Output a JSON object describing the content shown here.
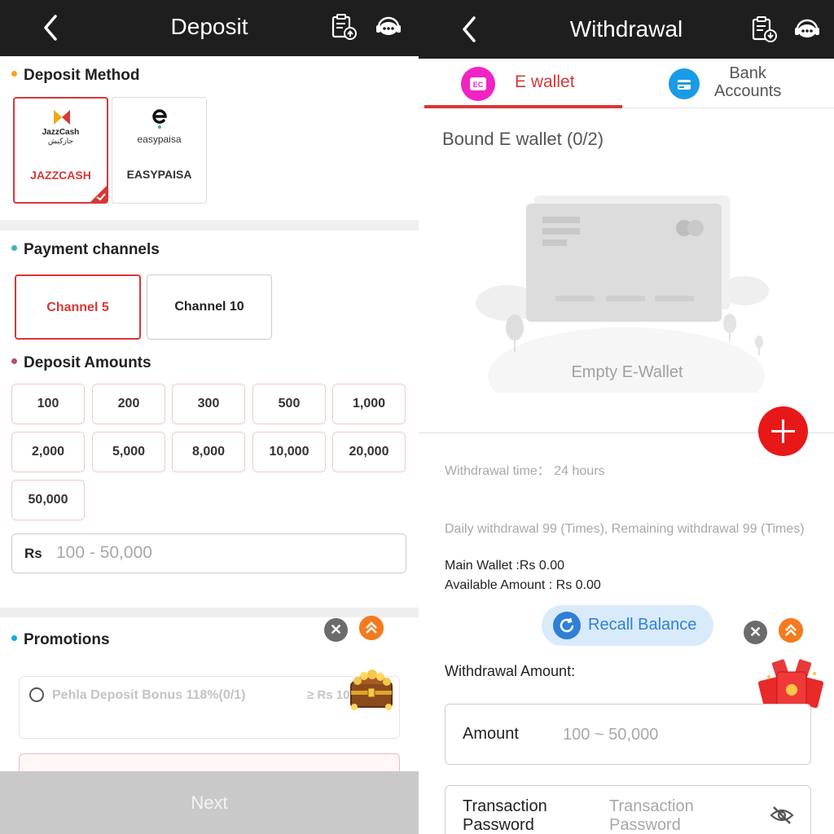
{
  "deposit": {
    "title": "Deposit",
    "method_title": "Deposit Method",
    "methods": [
      {
        "logo_line1": "JazzCash",
        "logo_line2": "جازکیش",
        "label": "JAZZCASH",
        "selected": true
      },
      {
        "logo_text": "easypaisa",
        "label": "EASYPAISA",
        "selected": false
      }
    ],
    "channels_title": "Payment channels",
    "channels": [
      {
        "label": "Channel 5",
        "selected": true
      },
      {
        "label": "Channel 10",
        "selected": false
      }
    ],
    "amounts_title": "Deposit Amounts",
    "amounts": [
      "100",
      "200",
      "300",
      "500",
      "1,000",
      "2,000",
      "5,000",
      "8,000",
      "10,000",
      "20,000",
      "50,000"
    ],
    "currency_prefix": "Rs",
    "amount_placeholder": "100 - 50,000",
    "promotions_title": "Promotions",
    "promo": {
      "label": "Pehla Deposit Bonus 118%(0/1)",
      "min": "≥ Rs 10"
    },
    "next_label": "Next",
    "close_glyph": "✕",
    "colors": {
      "accent": "#d93737",
      "topbar": "#1e1e1e",
      "dot_method": "#f4a417",
      "dot_channels": "#3fb8a6",
      "dot_amounts": "#b0506e",
      "dot_promotions": "#1aa3e8"
    }
  },
  "withdrawal": {
    "title": "Withdrawal",
    "tabs": [
      {
        "label": "E wallet",
        "icon": "ewallet-icon",
        "active": true
      },
      {
        "label": "Bank\nAccounts",
        "icon": "bank-icon",
        "active": false
      }
    ],
    "bound_label": "Bound E wallet (0/2)",
    "empty_label": "Empty E-Wallet",
    "withdrawal_time": "Withdrawal time：  24 hours",
    "daily_limits": "Daily withdrawal 99 (Times), Remaining withdrawal 99 (Times)",
    "main_wallet": "Main Wallet :Rs 0.00",
    "available_amount": "Available Amount : Rs 0.00",
    "recall_label": "Recall Balance",
    "amount_section_label": "Withdrawal Amount:",
    "amount_field_label": "Amount",
    "amount_placeholder": "100 ~ 50,000",
    "password_label": "Transaction\nPassword",
    "password_placeholder": "Transaction\nPassword",
    "close_glyph": "✕",
    "colors": {
      "ewallet_icon": "#f223c5",
      "bank_icon": "#1a9be8",
      "add_button": "#e81818",
      "recall_bg": "#d9ebfb",
      "recall_text": "#2f7fd6"
    }
  }
}
